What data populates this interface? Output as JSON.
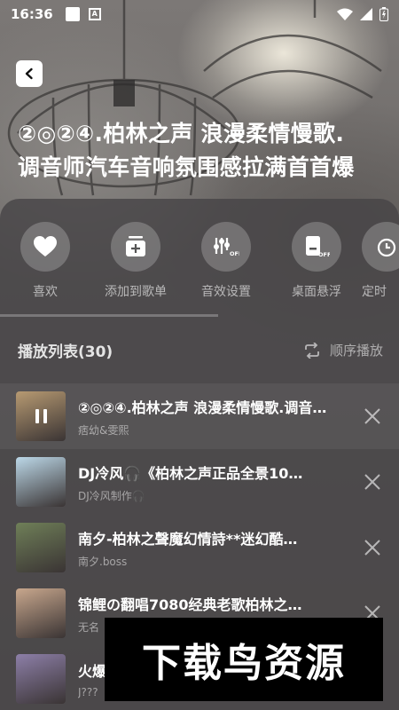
{
  "status_bar": {
    "time": "16:36"
  },
  "header": {
    "title": "②◎②④.柏林之声 浪漫柔情慢歌.调音师汽车音响氛围感拉满首首爆"
  },
  "actions": [
    {
      "label": "喜欢",
      "icon": "heart-icon"
    },
    {
      "label": "添加到歌单",
      "icon": "add-to-playlist-icon"
    },
    {
      "label": "音效设置",
      "icon": "equalizer-off-icon"
    },
    {
      "label": "桌面悬浮",
      "icon": "floating-lyrics-off-icon"
    },
    {
      "label": "定时",
      "icon": "timer-icon"
    }
  ],
  "playlist": {
    "title": "播放列表(30)",
    "mode_label": "顺序播放",
    "items": [
      {
        "name": "②◎②④.柏林之声 浪漫柔情慢歌.调音师汽车音响氛围感拉满首首爆",
        "artist": "痞幼&雯熙",
        "thumb_color": "#b79a72"
      },
      {
        "name": "DJ冷风🎧《柏林之声正品全景10…",
        "artist": "DJ冷风制作🎧",
        "thumb_color": "#bcd8e8"
      },
      {
        "name": "南夕-柏林之聲魔幻情詩**迷幻酷…",
        "artist": "南夕.boss",
        "thumb_color": "#6f7f58"
      },
      {
        "name": "锦鲤の翻唱7080经典老歌柏林之…",
        "artist": "无名",
        "thumb_color": "#c8a78d"
      },
      {
        "name": "火爆",
        "artist": "J???",
        "thumb_color": "#8d7fa8"
      }
    ]
  },
  "watermark": "下载鸟资源"
}
